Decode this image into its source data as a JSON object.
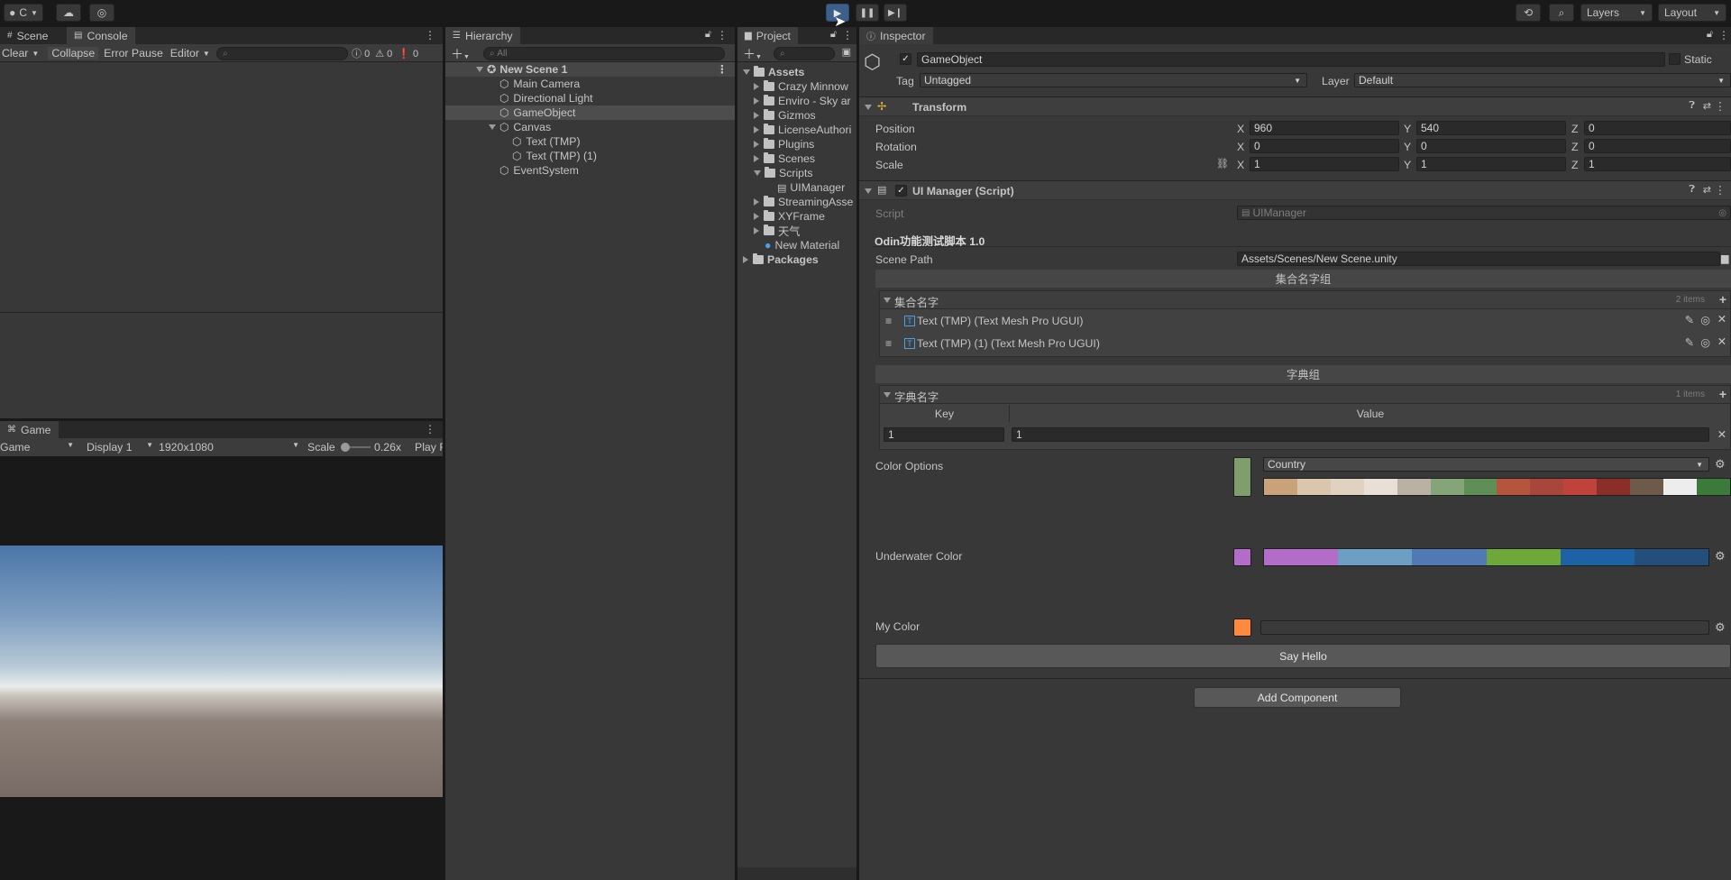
{
  "toolbar": {
    "account_label": "C",
    "layers_label": "Layers",
    "layout_label": "Layout"
  },
  "scene_panel": {
    "tabs": [
      "Scene",
      "Console"
    ],
    "console_buttons": [
      "Clear",
      "Collapse",
      "Error Pause",
      "Editor"
    ],
    "counts": [
      "0",
      "0",
      "0"
    ]
  },
  "game_panel": {
    "tab": "Game",
    "mode": "Game",
    "display": "Display 1",
    "resolution": "1920x1080",
    "scale_label": "Scale",
    "scale_value": "0.26x",
    "play_label": "Play F"
  },
  "hierarchy": {
    "tab": "Hierarchy",
    "search_placeholder": "All",
    "items": [
      {
        "label": "New Scene 1"
      },
      {
        "label": "Main Camera"
      },
      {
        "label": "Directional Light"
      },
      {
        "label": "GameObject"
      },
      {
        "label": "Canvas"
      },
      {
        "label": "Text (TMP)"
      },
      {
        "label": "Text (TMP) (1)"
      },
      {
        "label": "EventSystem"
      }
    ]
  },
  "project": {
    "tab": "Project",
    "items": [
      {
        "label": "Assets"
      },
      {
        "label": "Crazy Minnow"
      },
      {
        "label": "Enviro - Sky ar"
      },
      {
        "label": "Gizmos"
      },
      {
        "label": "LicenseAuthori"
      },
      {
        "label": "Plugins"
      },
      {
        "label": "Scenes"
      },
      {
        "label": "Scripts"
      },
      {
        "label": "UIManager"
      },
      {
        "label": "StreamingAsse"
      },
      {
        "label": "XYFrame"
      },
      {
        "label": "天气"
      },
      {
        "label": "New Material"
      },
      {
        "label": "Packages"
      }
    ]
  },
  "inspector": {
    "tab": "Inspector",
    "object_name": "GameObject",
    "static_label": "Static",
    "tag_label": "Tag",
    "tag_value": "Untagged",
    "layer_label": "Layer",
    "layer_value": "Default",
    "transform": {
      "title": "Transform",
      "position_label": "Position",
      "rotation_label": "Rotation",
      "scale_label": "Scale",
      "position": {
        "x": "960",
        "y": "540",
        "z": "0"
      },
      "rotation": {
        "x": "0",
        "y": "0",
        "z": "0"
      },
      "scale": {
        "x": "1",
        "y": "1",
        "z": "1"
      },
      "axis_x": "X",
      "axis_y": "Y",
      "axis_z": "Z"
    },
    "script_comp": {
      "title": "UI Manager (Script)",
      "script_label": "Script",
      "script_value": "UIManager",
      "odin_title": "Odin功能测试脚本 1.0",
      "scene_path_label": "Scene Path",
      "scene_path_value": "Assets/Scenes/New Scene.unity",
      "group1_title": "集合名字组",
      "list1_label": "集合名字",
      "list1_count": "2 items",
      "list1_items": [
        "Text (TMP) (Text Mesh Pro UGUI)",
        "Text (TMP) (1) (Text Mesh Pro UGUI)"
      ],
      "group2_title": "字典组",
      "dict_label": "字典名字",
      "dict_count": "1 items",
      "key_header": "Key",
      "value_header": "Value",
      "dict_key": "1",
      "dict_value": "1",
      "color_options_label": "Color Options",
      "color_options_dropdown": "Country",
      "underwater_label": "Underwater Color",
      "my_color_label": "My Color",
      "say_hello": "Say Hello"
    },
    "add_component": "Add Component"
  },
  "colors": {
    "color_options_swatch": "#7e9e6e",
    "underwater_swatch": "#b36cc7",
    "my_color_swatch": "#ff8a3d",
    "country_palette": [
      "#c9a27a",
      "#d9c6ad",
      "#e0d1c0",
      "#e8e0d6",
      "#b9b1a4",
      "#86a47a",
      "#5f8f57",
      "#b5553e",
      "#a8463b",
      "#c0433b",
      "#8b2e2a",
      "#6d5a4a",
      "#ededed",
      "#3c7a3c"
    ],
    "underwater_palette": [
      "#b36cc7",
      "#6d9fc4",
      "#5179b4",
      "#6ea83a",
      "#1e62a6",
      "#244f7c"
    ]
  }
}
